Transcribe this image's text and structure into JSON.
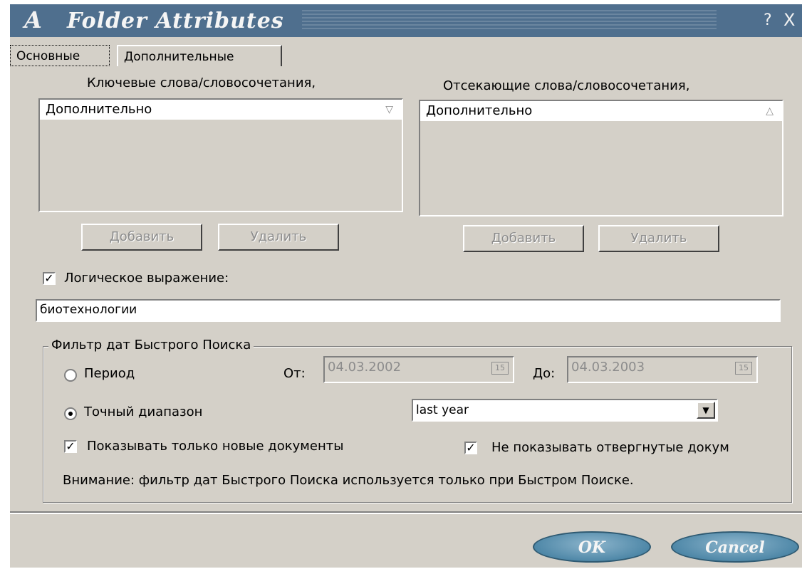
{
  "window": {
    "logo": "A",
    "title": "Folder Attributes",
    "help_glyph": "?",
    "close_glyph": "X"
  },
  "tabs": [
    {
      "label": "Основные",
      "active": true
    },
    {
      "label": "Дополнительные",
      "active": false
    }
  ],
  "keywords": {
    "label": "Ключевые слова/словосочетания,",
    "header": "Дополнительно",
    "sort_icon": "triangle-down-icon",
    "add_label": "Добавить",
    "remove_label": "Удалить"
  },
  "exclusions": {
    "label": "Отсекающие слова/словосочетания,",
    "header": "Дополнительно",
    "sort_icon": "triangle-up-icon",
    "add_label": "Добавить",
    "remove_label": "Удалить"
  },
  "logical": {
    "checked": true,
    "label": "Логическое выражение:",
    "value": "биотехнологии"
  },
  "date_filter": {
    "group_label": "Фильтр дат Быстрого Поиска",
    "period_label": "Период",
    "from_label": "От:",
    "from_value": "04.03.2002",
    "to_label": "До:",
    "to_value": "04.03.2003",
    "calendar_glyph": "15",
    "exact_label": "Точный диапазон",
    "exact_selected": true,
    "range_value": "last year",
    "new_docs_label": "Показывать только новые документы",
    "rejected_label": "Не показывать отвергнутые докум",
    "note": "Внимание: фильтр дат Быстрого Поиска используется только при Быстром Поиске."
  },
  "buttons": {
    "ok": "OK",
    "cancel": "Cancel"
  }
}
